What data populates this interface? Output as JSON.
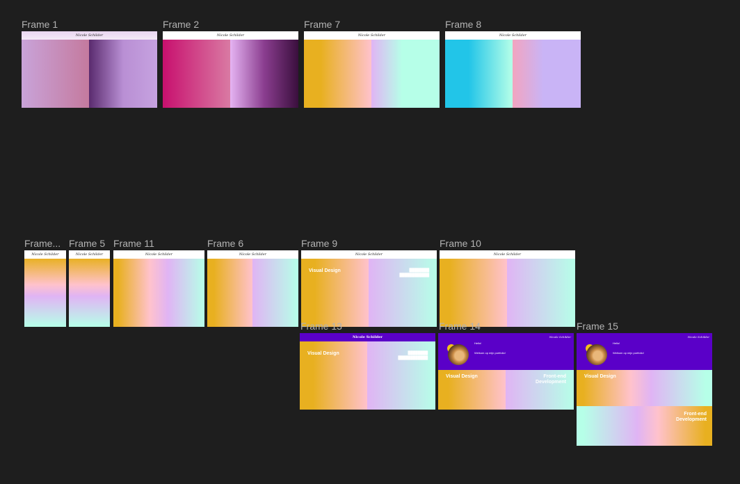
{
  "canvas": {
    "background": "#1e1e1e"
  },
  "frames": {
    "f1": {
      "label": "Frame 1"
    },
    "f2": {
      "label": "Frame 2"
    },
    "f7": {
      "label": "Frame 7"
    },
    "f8": {
      "label": "Frame 8"
    },
    "f4": {
      "label": "Frame..."
    },
    "f5": {
      "label": "Frame 5"
    },
    "f11": {
      "label": "Frame 11"
    },
    "f6": {
      "label": "Frame 6"
    },
    "f9": {
      "label": "Frame 9"
    },
    "f10": {
      "label": "Frame 10"
    },
    "f13": {
      "label": "Frame 13"
    },
    "f14": {
      "label": "Frame 14"
    },
    "f15": {
      "label": "Frame 15"
    }
  },
  "content": {
    "signature": "Nicole Schilder",
    "header_name": "Nicole Schilder",
    "visual_design": "Visual Design",
    "frontend_line1": "Front-end",
    "frontend_line2": "Development",
    "hello": "Hello!",
    "welcome": "Welkom op mijn portfolio!",
    "blurred_line1": "████████",
    "blurred_line2": "████████████"
  },
  "colors": {
    "purple_header": "#5a00c8",
    "gold": "#e8b020",
    "pink": "#ffc0cb",
    "lavender": "#e0b0ff",
    "mint": "#b4ffe8"
  }
}
